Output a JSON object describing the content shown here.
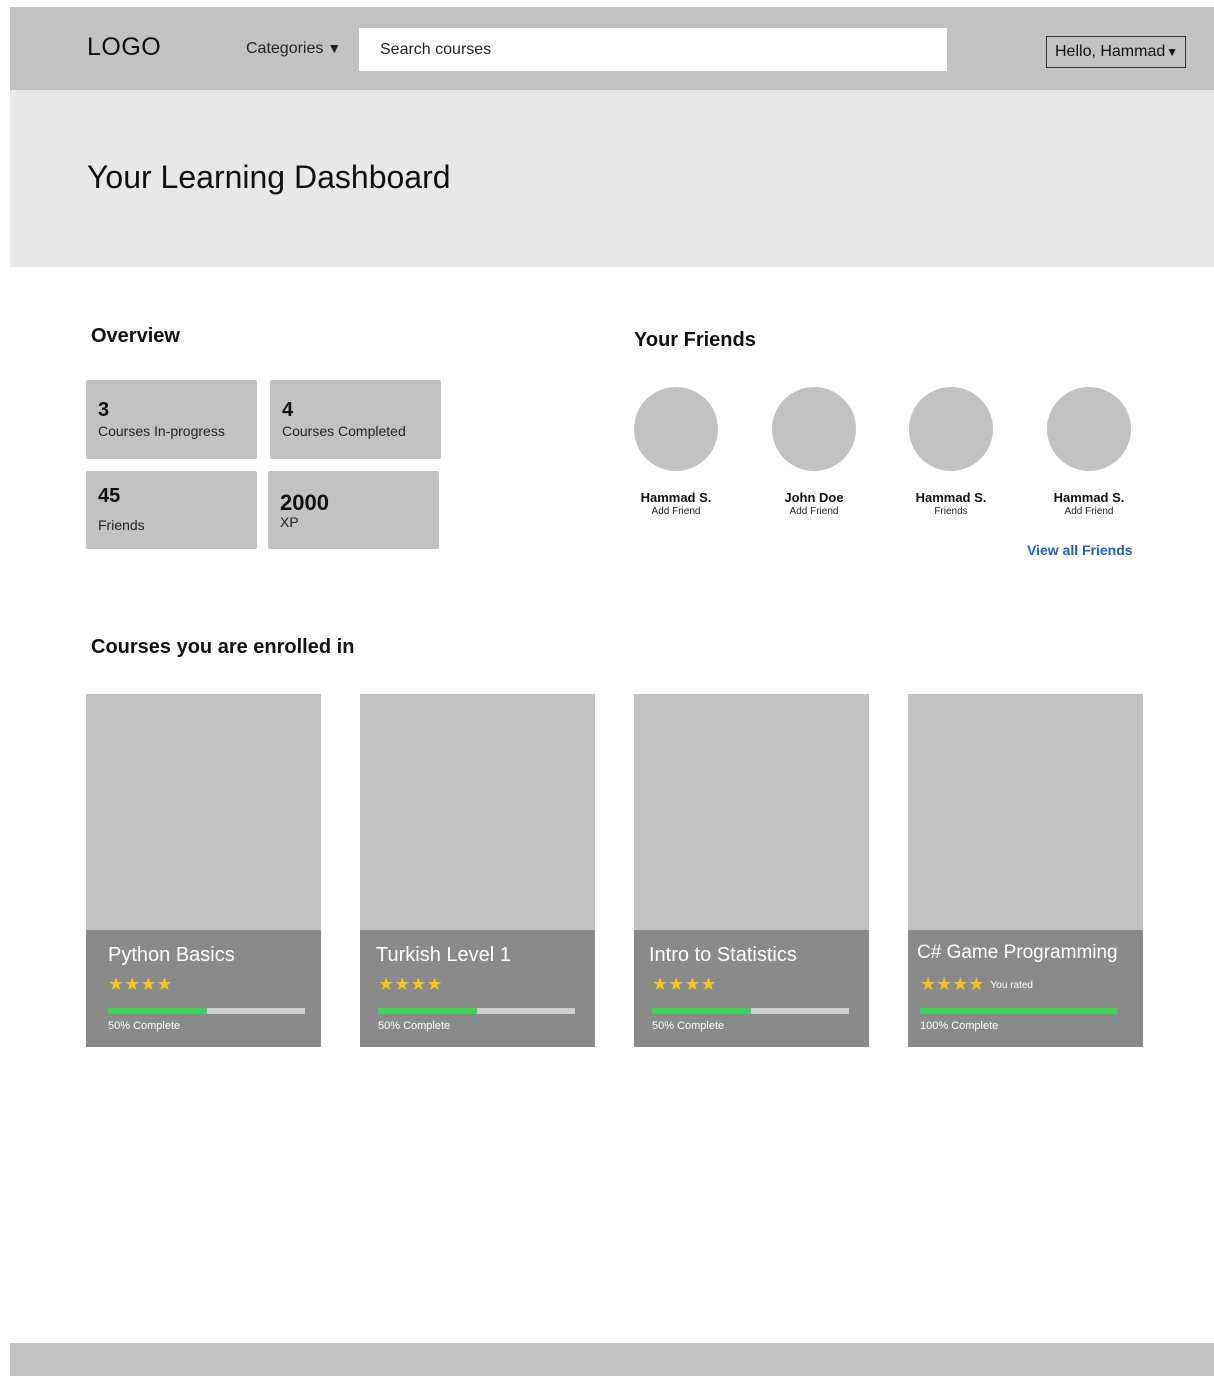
{
  "header": {
    "logo": "LOGO",
    "categories_label": "Categories",
    "search_placeholder": "Search courses",
    "user_greeting": "Hello, Hammad"
  },
  "hero": {
    "title": "Your Learning Dashboard"
  },
  "overview": {
    "title": "Overview",
    "stats": [
      {
        "value": "3",
        "label": "Courses In-progress"
      },
      {
        "value": "4",
        "label": "Courses Completed"
      },
      {
        "value": "45",
        "label": "Friends"
      },
      {
        "value": "2000",
        "label": "XP"
      }
    ]
  },
  "friends": {
    "title": "Your Friends",
    "items": [
      {
        "name": "Hammad S.",
        "action": "Add Friend"
      },
      {
        "name": "John Doe",
        "action": "Add Friend"
      },
      {
        "name": "Hammad S.",
        "action": "Friends"
      },
      {
        "name": "Hammad S.",
        "action": "Add Friend"
      }
    ],
    "view_all": "View all Friends"
  },
  "courses": {
    "title": "Courses you are enrolled in",
    "items": [
      {
        "title": "Python Basics",
        "stars": "★★★★",
        "rated_label": "",
        "progress": 0.5,
        "progress_label": "50% Complete"
      },
      {
        "title": "Turkish Level 1",
        "stars": "★★★★",
        "rated_label": "",
        "progress": 0.5,
        "progress_label": "50% Complete"
      },
      {
        "title": "Intro to Statistics",
        "stars": "★★★★",
        "rated_label": "",
        "progress": 0.5,
        "progress_label": "50% Complete"
      },
      {
        "title": "C# Game Programming",
        "stars": "★★★★",
        "rated_label": "You rated",
        "progress": 1.0,
        "progress_label": "100% Complete"
      }
    ]
  },
  "colors": {
    "progress_fill": "#3fd15a",
    "star": "#f5c518",
    "link": "#1a5fc8"
  }
}
